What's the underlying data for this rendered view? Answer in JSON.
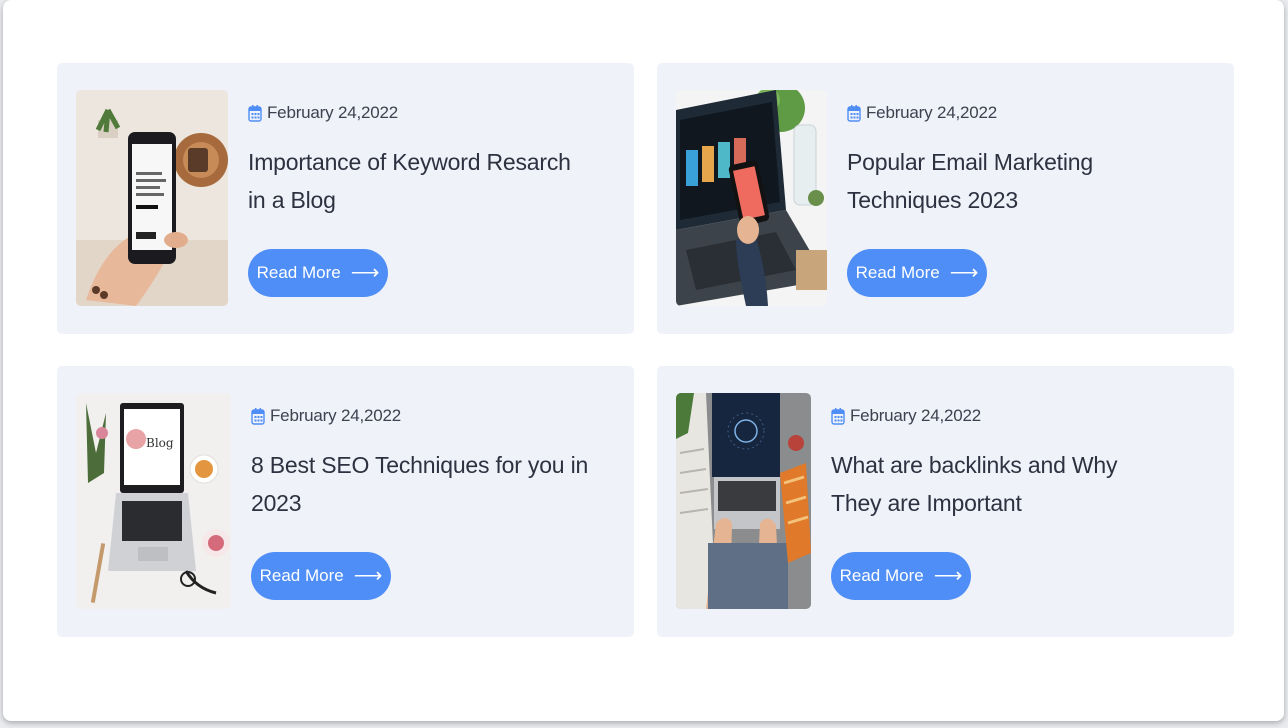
{
  "posts": [
    {
      "date": "February 24,2022",
      "title": "Importance of Keyword Resarch in a Blog",
      "button_label": "Read More",
      "image": "phone-in-hand"
    },
    {
      "date": "February 24,2022",
      "title": "Popular Email Marketing Techniques 2023",
      "button_label": "Read More",
      "image": "laptop-and-phone"
    },
    {
      "date": "February 24,2022",
      "title": "8 Best SEO Techniques for you in 2023",
      "button_label": "Read More",
      "image": "laptop-blog-desk"
    },
    {
      "date": "February 24,2022",
      "title": "What are backlinks and Why They are Important",
      "button_label": "Read More",
      "image": "typing-on-laptop"
    }
  ],
  "icons": {
    "date": "calendar-icon",
    "button": "arrow-right-icon"
  },
  "colors": {
    "accent": "#4f8ef6",
    "card": "#eff2f8",
    "text": "#2d3140"
  }
}
